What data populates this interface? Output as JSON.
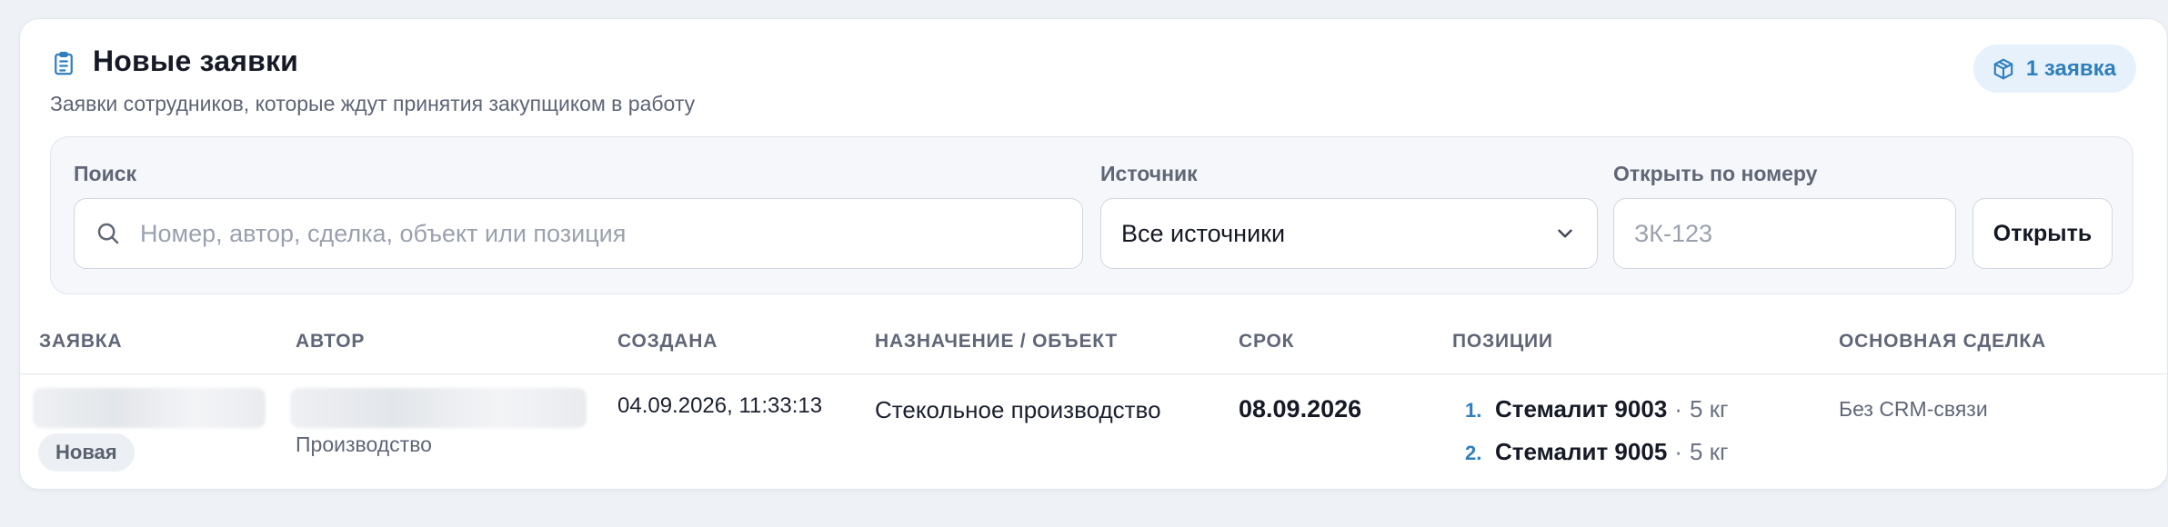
{
  "header": {
    "title": "Новые заявки",
    "subtitle": "Заявки сотрудников, которые ждут принятия закупщиком в работу",
    "count_badge": "1 заявка",
    "title_icon": "clipboard-list-icon",
    "badge_icon": "package-icon"
  },
  "filters": {
    "search": {
      "label": "Поиск",
      "placeholder": "Номер, автор, сделка, объект или позиция",
      "value": ""
    },
    "source": {
      "label": "Источник",
      "value": "Все источники"
    },
    "open_by_number": {
      "label": "Открыть по номеру",
      "placeholder": "ЗК-123",
      "value": ""
    },
    "open_button": "Открыть"
  },
  "table": {
    "columns": [
      "Заявка",
      "Автор",
      "Создана",
      "Назначение / объект",
      "Срок",
      "Позиции",
      "Основная сделка"
    ],
    "rows": [
      {
        "status": "Новая",
        "author_department": "Производство",
        "created": "04.09.2026, 11:33:13",
        "purpose": "Стекольное производство",
        "deadline": "08.09.2026",
        "positions": [
          {
            "num": "1.",
            "name": "Стемалит 9003",
            "sep": "·",
            "qty": "5 кг"
          },
          {
            "num": "2.",
            "name": "Стемалит 9005",
            "sep": "·",
            "qty": "5 кг"
          }
        ],
        "deal": "Без CRM-связи"
      }
    ]
  },
  "colors": {
    "accent": "#2f7fbf",
    "badge_bg": "#e7f1fb",
    "page_bg": "#eef1f6",
    "status_bg": "#eceff3"
  }
}
